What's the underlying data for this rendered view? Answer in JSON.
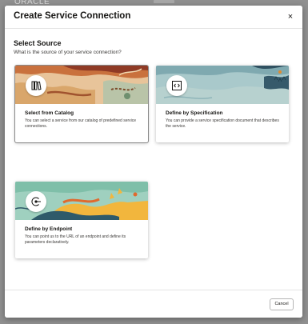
{
  "background": {
    "brand_text": "ORACLE"
  },
  "dialog": {
    "title": "Create Service Connection",
    "close_label": "×"
  },
  "body": {
    "section_title": "Select Source",
    "section_subtitle": "What is the source of your service connection?"
  },
  "cards": [
    {
      "title": "Select from Catalog",
      "description": "You can select a service from our catalog of predefined service connections.",
      "icon": "book-icon",
      "selected": true
    },
    {
      "title": "Define by Specification",
      "description": "You can provide a service specification document that describes the service.",
      "icon": "code-icon",
      "selected": false
    },
    {
      "title": "Define by Endpoint",
      "description": "You can point us to the URL of an endpoint and define its parameters declaratively.",
      "icon": "endpoint-icon",
      "selected": false
    }
  ],
  "footer": {
    "cancel_label": "Cancel"
  },
  "colors": {
    "overlay": "#909090",
    "catalog_art": "#d9a66b",
    "spec_art": "#9fc2c4",
    "endpoint_art": "#8fc7b5"
  }
}
